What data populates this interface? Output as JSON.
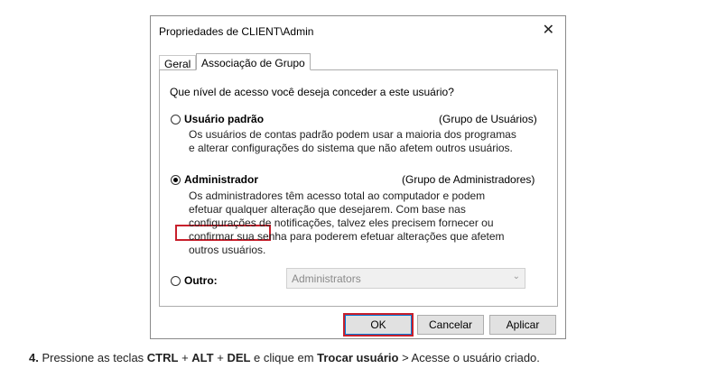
{
  "dialog": {
    "title": "Propriedades de CLIENT\\Admin",
    "close_glyph": "✕",
    "tabs": [
      {
        "label": "Geral"
      },
      {
        "label": "Associação de Grupo"
      }
    ],
    "question": "Que nível de acesso você deseja conceder a este usuário?",
    "options": [
      {
        "label": "Usuário padrão",
        "group": "(Grupo de Usuários)",
        "selected": false,
        "desc": [
          "Os usuários de contas padrão podem usar a maioria dos programas",
          "e alterar configurações do sistema que não afetem outros usuários."
        ]
      },
      {
        "label": "Administrador",
        "group": "(Grupo de Administradores)",
        "selected": true,
        "desc": [
          "Os administradores têm acesso total ao computador e podem",
          "efetuar qualquer alteração que desejarem. Com base nas",
          "configurações de notificações, talvez eles precisem fornecer ou",
          "confirmar sua senha para poderem efetuar alterações que afetem",
          "outros usuários."
        ]
      },
      {
        "label": "Outro:",
        "selected": false
      }
    ],
    "other_select": {
      "value": "Administrators"
    },
    "buttons": {
      "ok": "OK",
      "cancel": "Cancelar",
      "apply": "Aplicar"
    }
  },
  "caption": {
    "num": "4.",
    "t1": " Pressione as teclas ",
    "k1": "CTRL",
    "t2": " + ",
    "k2": "ALT",
    "t3": " + ",
    "k3": "DEL",
    "t4": " e clique em ",
    "k4": "Trocar usuário",
    "t5": " > Acesse o usuário criado."
  },
  "colors": {
    "highlight": "#c8202c",
    "ok_border": "#0078d7"
  }
}
